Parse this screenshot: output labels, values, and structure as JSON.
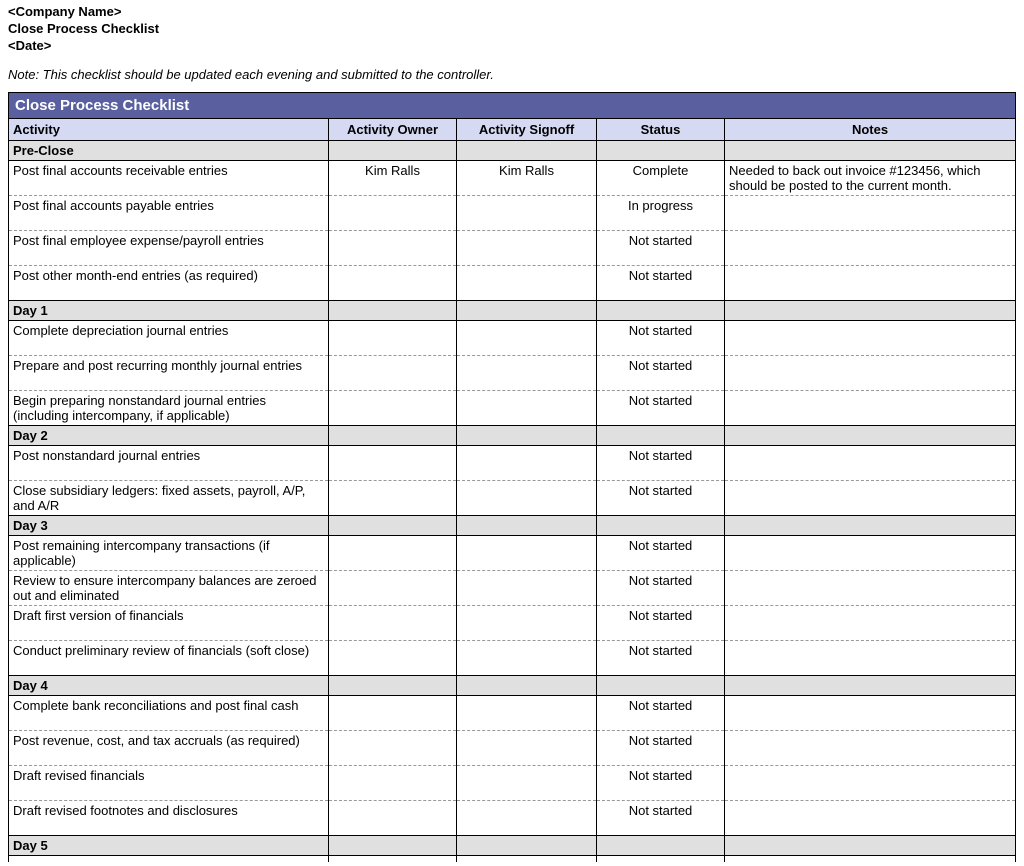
{
  "header": {
    "company": "<Company Name>",
    "title": "Close Process Checklist",
    "date": "<Date>",
    "note": "Note: This checklist should be updated each evening and submitted to the controller."
  },
  "table": {
    "title": "Close Process Checklist",
    "columns": {
      "activity": "Activity",
      "owner": "Activity Owner",
      "signoff": "Activity Signoff",
      "status": "Status",
      "notes": "Notes"
    },
    "sections": [
      {
        "name": "Pre-Close",
        "rows": [
          {
            "activity": "Post final accounts receivable entries",
            "owner": "Kim Ralls",
            "signoff": "Kim Ralls",
            "status": "Complete",
            "notes": "Needed to back out invoice #123456, which should be posted to the current month."
          },
          {
            "activity": "Post final accounts payable entries",
            "owner": "",
            "signoff": "",
            "status": "In progress",
            "notes": ""
          },
          {
            "activity": "Post final employee expense/payroll entries",
            "owner": "",
            "signoff": "",
            "status": "Not started",
            "notes": ""
          },
          {
            "activity": "Post other month-end entries (as required)",
            "owner": "",
            "signoff": "",
            "status": "Not started",
            "notes": ""
          }
        ]
      },
      {
        "name": "Day 1",
        "rows": [
          {
            "activity": "Complete depreciation journal entries",
            "owner": "",
            "signoff": "",
            "status": "Not started",
            "notes": ""
          },
          {
            "activity": "Prepare and post recurring monthly journal entries",
            "owner": "",
            "signoff": "",
            "status": "Not started",
            "notes": ""
          },
          {
            "activity": "Begin preparing nonstandard journal entries (including intercompany, if applicable)",
            "owner": "",
            "signoff": "",
            "status": "Not started",
            "notes": ""
          }
        ]
      },
      {
        "name": "Day 2",
        "rows": [
          {
            "activity": "Post nonstandard journal entries",
            "owner": "",
            "signoff": "",
            "status": "Not started",
            "notes": ""
          },
          {
            "activity": "Close subsidiary ledgers: fixed assets, payroll, A/P, and A/R",
            "owner": "",
            "signoff": "",
            "status": "Not started",
            "notes": ""
          }
        ]
      },
      {
        "name": "Day 3",
        "rows": [
          {
            "activity": "Post remaining intercompany transactions (if applicable)",
            "owner": "",
            "signoff": "",
            "status": "Not started",
            "notes": ""
          },
          {
            "activity": "Review to ensure intercompany balances are zeroed out and eliminated",
            "owner": "",
            "signoff": "",
            "status": "Not started",
            "notes": ""
          },
          {
            "activity": "Draft first version of financials",
            "owner": "",
            "signoff": "",
            "status": "Not started",
            "notes": ""
          },
          {
            "activity": "Conduct preliminary review of financials (soft close)",
            "owner": "",
            "signoff": "",
            "status": "Not started",
            "notes": ""
          }
        ]
      },
      {
        "name": "Day 4",
        "rows": [
          {
            "activity": "Complete bank reconciliations and post final cash",
            "owner": "",
            "signoff": "",
            "status": "Not started",
            "notes": ""
          },
          {
            "activity": "Post revenue, cost, and tax accruals (as required)",
            "owner": "",
            "signoff": "",
            "status": "Not started",
            "notes": ""
          },
          {
            "activity": "Draft revised financials",
            "owner": "",
            "signoff": "",
            "status": "Not started",
            "notes": ""
          },
          {
            "activity": "Draft revised footnotes and disclosures",
            "owner": "",
            "signoff": "",
            "status": "Not started",
            "notes": ""
          }
        ]
      },
      {
        "name": "Day 5",
        "rows": []
      }
    ]
  }
}
